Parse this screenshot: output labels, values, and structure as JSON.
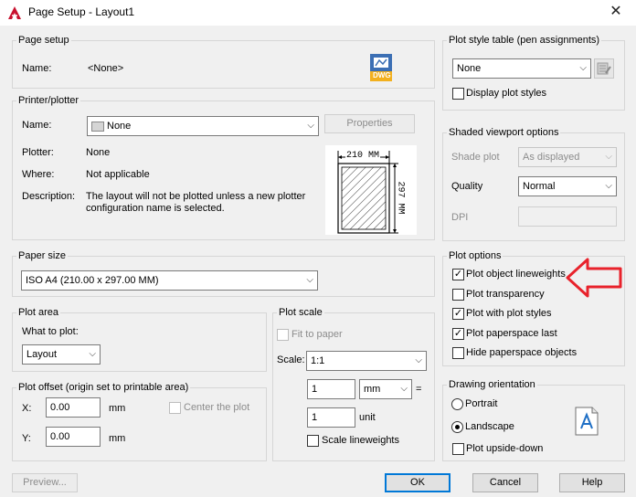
{
  "window": {
    "title": "Page Setup - Layout1",
    "close_glyph": "✕"
  },
  "page_setup": {
    "legend": "Page setup",
    "name_label": "Name:",
    "name_value": "<None>",
    "dwg_label": "DWG"
  },
  "printer": {
    "legend": "Printer/plotter",
    "name_label": "Name:",
    "name_value": "None",
    "properties_label": "Properties",
    "plotter_label": "Plotter:",
    "plotter_value": "None",
    "where_label": "Where:",
    "where_value": "Not applicable",
    "description_label": "Description:",
    "description_line1": "The layout will not be plotted unless a new plotter",
    "description_line2": "configuration name is selected.",
    "preview_width": "210  MM",
    "preview_height": "297  MM"
  },
  "paper_size": {
    "legend": "Paper size",
    "value": "ISO A4 (210.00 x 297.00 MM)"
  },
  "plot_area": {
    "legend": "Plot area",
    "what_label": "What to plot:",
    "value": "Layout"
  },
  "plot_offset": {
    "legend": "Plot offset (origin set to printable area)",
    "x_label": "X:",
    "x_value": "0.00",
    "x_unit": "mm",
    "y_label": "Y:",
    "y_value": "0.00",
    "y_unit": "mm",
    "center_label": "Center the plot"
  },
  "plot_scale": {
    "legend": "Plot scale",
    "fit_label": "Fit to paper",
    "scale_label": "Scale:",
    "scale_value": "1:1",
    "val1": "1",
    "unit_select": "mm",
    "equals": "=",
    "val2": "1",
    "unit_text": "unit",
    "scale_lw_label": "Scale lineweights"
  },
  "plot_style_table": {
    "legend": "Plot style table (pen assignments)",
    "value": "None",
    "display_label": "Display plot styles"
  },
  "shaded": {
    "legend": "Shaded viewport options",
    "shade_label": "Shade plot",
    "shade_value": "As displayed",
    "quality_label": "Quality",
    "quality_value": "Normal",
    "dpi_label": "DPI"
  },
  "plot_options": {
    "legend": "Plot options",
    "items": [
      {
        "label": "Plot object lineweights",
        "checked": true
      },
      {
        "label": "Plot transparency",
        "checked": false
      },
      {
        "label": "Plot with plot styles",
        "checked": true
      },
      {
        "label": "Plot paperspace last",
        "checked": true
      },
      {
        "label": "Hide paperspace objects",
        "checked": false
      }
    ]
  },
  "orientation": {
    "legend": "Drawing orientation",
    "portrait": "Portrait",
    "landscape": "Landscape",
    "upside_down": "Plot upside-down",
    "selected": "Landscape"
  },
  "buttons": {
    "preview": "Preview...",
    "ok": "OK",
    "cancel": "Cancel",
    "help": "Help"
  },
  "colors": {
    "accent": "#0078d7",
    "annotation_arrow": "#e8222b",
    "autocad_red": "#c8102e"
  }
}
